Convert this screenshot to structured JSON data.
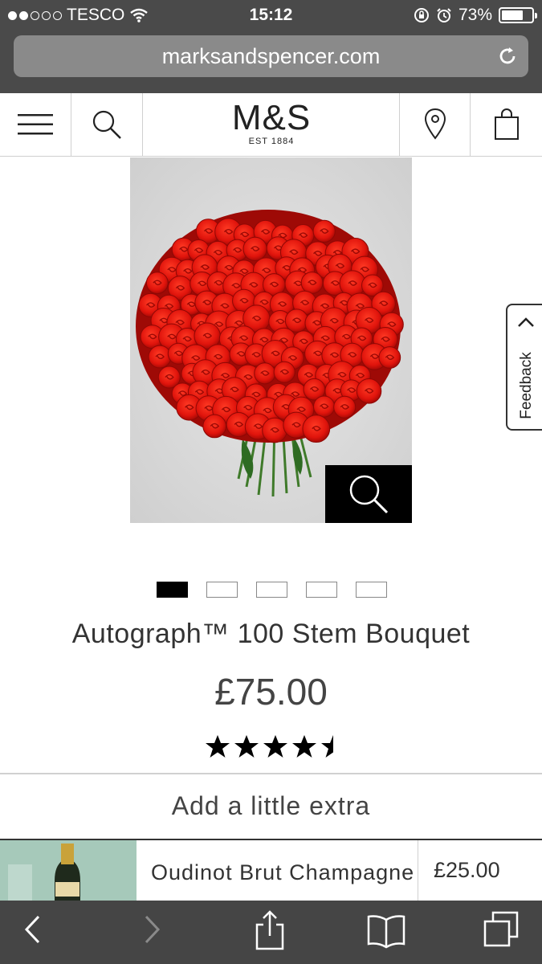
{
  "status_bar": {
    "carrier": "TESCO",
    "time": "15:12",
    "battery": "73%",
    "signal_bars_filled": 2,
    "signal_bars_total": 5,
    "battery_level": 0.73
  },
  "browser": {
    "url": "marksandspencer.com"
  },
  "header": {
    "logo_text": "M&S",
    "logo_subtext": "EST 1884"
  },
  "product": {
    "title": "Autograph™ 100 Stem Bouquet",
    "price": "£75.00",
    "rating": 4.5,
    "rating_max": 5,
    "image_count": 5,
    "active_image": 1
  },
  "feedback": {
    "label": "Feedback"
  },
  "extras": {
    "heading": "Add a little extra",
    "items": [
      {
        "name": "Oudinot Brut Champagne",
        "price": "£25.00"
      }
    ]
  },
  "colors": {
    "chrome": "#4a4a4a",
    "toolbar": "#454545",
    "rose_red": "#e0140c",
    "zoom_bg": "#000000"
  }
}
